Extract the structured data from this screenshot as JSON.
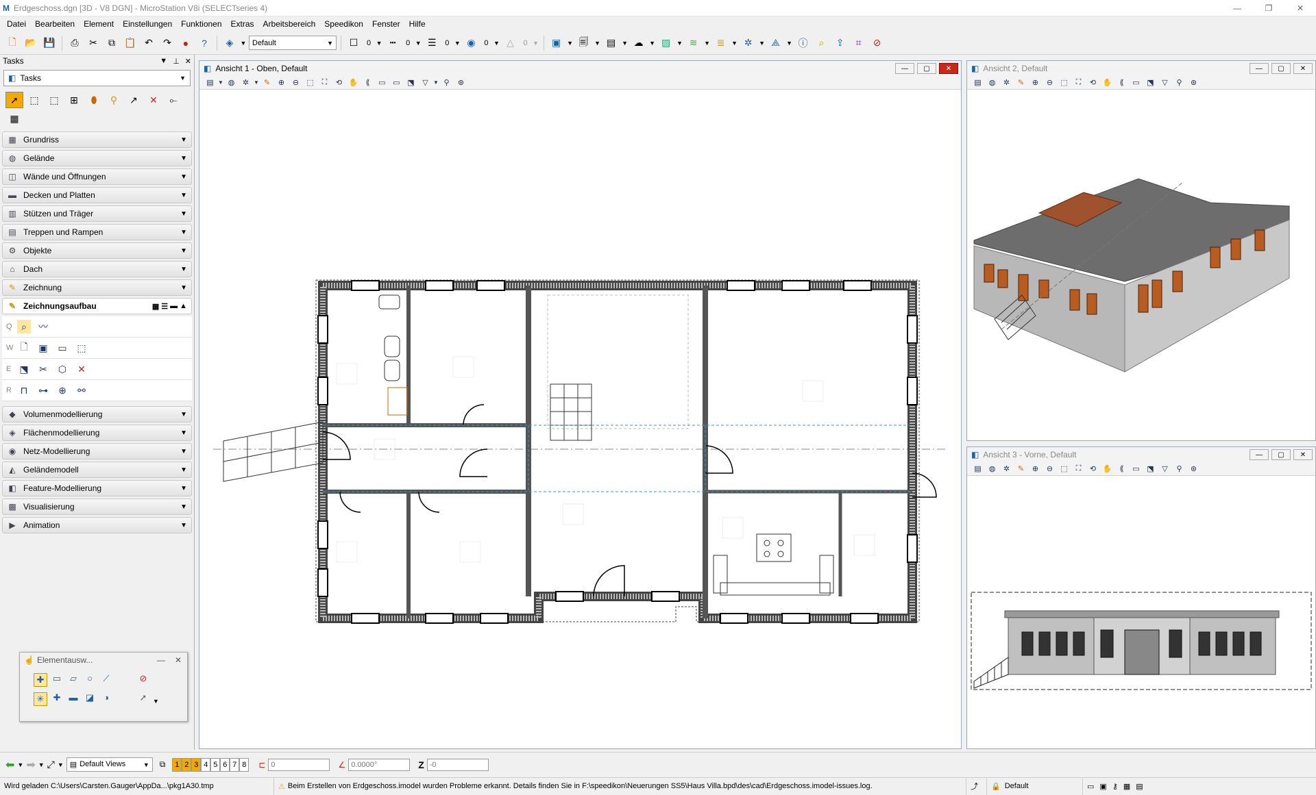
{
  "window": {
    "title": "Erdgeschoss.dgn [3D - V8 DGN] - MicroStation V8i (SELECTseries 4)"
  },
  "menu": [
    "Datei",
    "Bearbeiten",
    "Element",
    "Einstellungen",
    "Funktionen",
    "Extras",
    "Arbeitsbereich",
    "Speedikon",
    "Fenster",
    "Hilfe"
  ],
  "toolbar": {
    "level": "Default",
    "color": "0",
    "style": "0",
    "weight": "0",
    "class": "0",
    "transparency": "0"
  },
  "tasks": {
    "title": "Tasks",
    "combo": "Tasks",
    "groups_top": [
      "Grundriss",
      "Gelände",
      "Wände und Öffnungen",
      "Decken und Platten",
      "Stützen und Träger",
      "Treppen und Rampen",
      "Objekte",
      "Dach",
      "Zeichnung"
    ],
    "open_group": "Zeichnungsaufbau",
    "sub_keys": [
      "Q",
      "W",
      "E",
      "R"
    ],
    "groups_bottom": [
      "Volumenmodellierung",
      "Flächenmodellierung",
      "Netz-Modellierung",
      "Geländemodell",
      "Feature-Modellierung",
      "Visualisierung",
      "Animation"
    ]
  },
  "views": {
    "v1": "Ansicht 1 - Oben, Default",
    "v2": "Ansicht 2, Default",
    "v3": "Ansicht 3 - Vorne, Default"
  },
  "elemsel": {
    "title": "Elementausw..."
  },
  "bottom": {
    "views_combo": "Default Views",
    "view_numbers": [
      "1",
      "2",
      "3",
      "4",
      "5",
      "6",
      "7",
      "8"
    ],
    "x_field": "0",
    "angle_field": "0.0000°",
    "z_label": "Z",
    "z_field": "-0"
  },
  "status": {
    "left": "Wird geladen C:\\Users\\Carsten.Gauger\\AppDa...\\pkg1A30.tmp",
    "message": "Beim Erstellen von Erdgeschoss.imodel wurden Probleme erkannt. Details finden Sie in F:\\speedikon\\Neuerungen SS5\\Haus Villa.bpd\\des\\cad\\Erdgeschoss.imodel-issues.log.",
    "level": "Default"
  },
  "colors": {
    "accent": "#f2a900",
    "view_border": "#99aabb",
    "wall_fill": "#555555"
  }
}
